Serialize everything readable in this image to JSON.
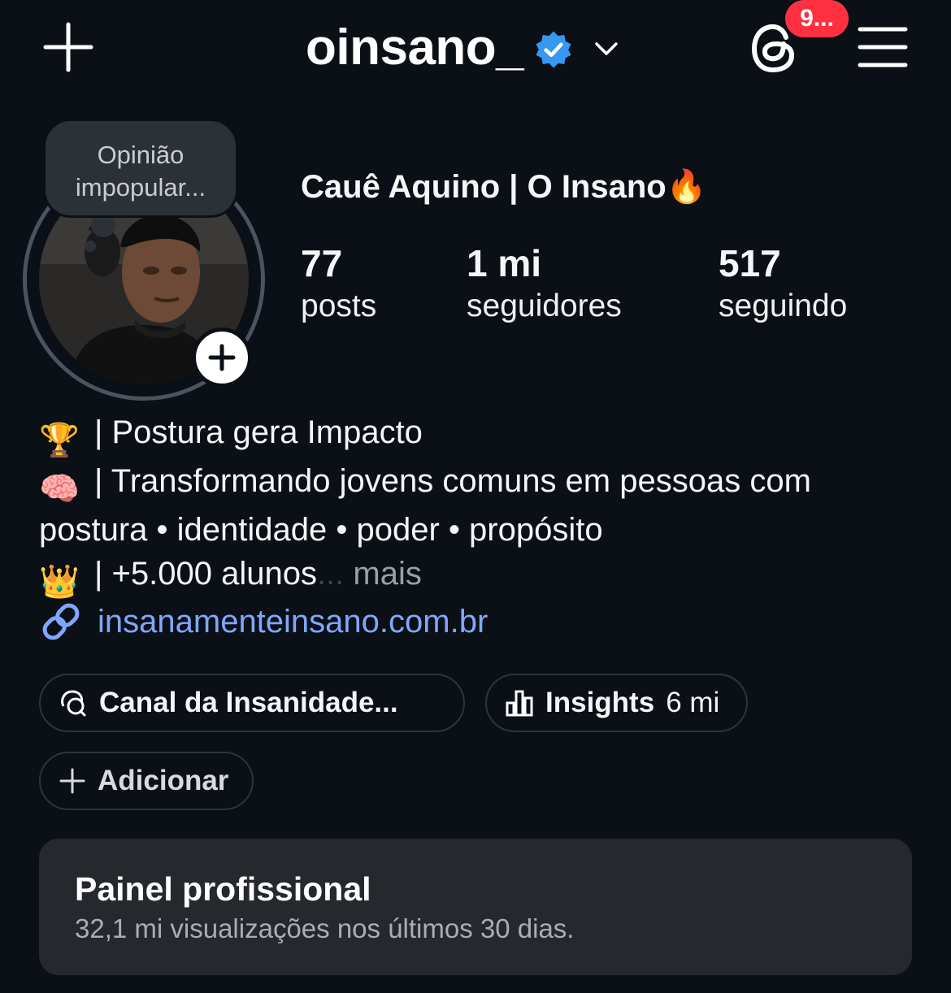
{
  "header": {
    "username": "oinsano_",
    "notification_badge": "9...",
    "icons": [
      "plus-icon",
      "verified-badge-icon",
      "chevron-down-icon",
      "threads-icon",
      "menu-icon"
    ]
  },
  "profile": {
    "note": "Opinião impopular...",
    "display_name": "Cauê Aquino | O Insano",
    "name_emoji": "🔥",
    "stats": [
      {
        "value": "77",
        "label": "posts"
      },
      {
        "value": "1 mi",
        "label": "seguidores"
      },
      {
        "value": "517",
        "label": "seguindo"
      }
    ]
  },
  "bio": {
    "line1_emoji": "🏆",
    "line1": "| Postura gera Impacto",
    "line2_emoji": "🧠",
    "line2": "| Transformando jovens comuns em pessoas com postura • identidade • poder • propósito",
    "line3_emoji": "👑",
    "line3": "| +5.000 alunos",
    "ellipsis": "...",
    "more": " mais"
  },
  "link": {
    "text": "insanamenteinsano.com.br",
    "icon": "link-icon"
  },
  "buttons": {
    "channel": "Canal da Insanidade...",
    "insights": "Insights",
    "insights_value": "6 mi",
    "add": "Adicionar"
  },
  "panel": {
    "title": "Painel profissional",
    "subtitle": "32,1 mi visualizações nos últimos 30 dias."
  },
  "colors": {
    "background": "#0b0f16",
    "link": "#7fa7ff",
    "badge": "#ff3040",
    "verified": "#3897f0",
    "panel": "#25282d"
  }
}
